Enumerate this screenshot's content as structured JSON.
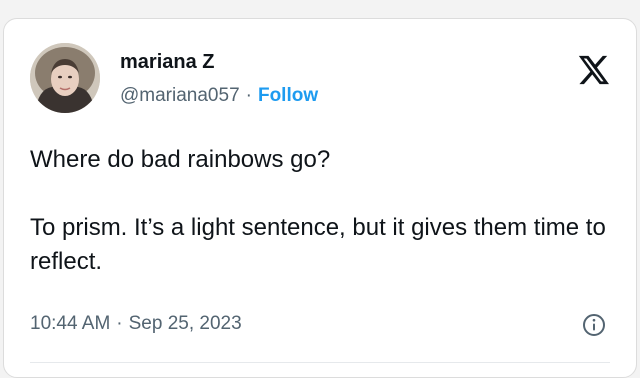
{
  "author": {
    "display_name": "mariana Z",
    "handle": "@mariana057",
    "separator": "·",
    "follow_label": "Follow"
  },
  "icons": {
    "logo": "x-logo-icon",
    "info": "info-icon"
  },
  "tweet": {
    "line1": "Where do bad rainbows go?",
    "line2": "To prism. It’s a light sentence, but it gives them time to reflect."
  },
  "meta": {
    "time": "10:44 AM",
    "separator": "·",
    "date": "Sep 25, 2023"
  },
  "colors": {
    "link": "#1d9bf0",
    "text": "#0f1419",
    "muted": "#536471"
  }
}
